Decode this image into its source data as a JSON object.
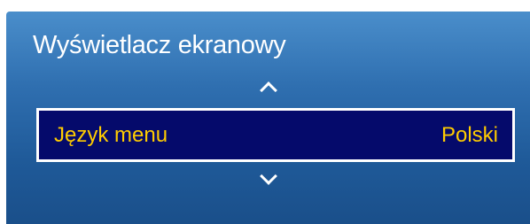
{
  "osd": {
    "title": "Wyświetlacz ekranowy",
    "menu_item": {
      "label": "Język menu",
      "value": "Polski"
    }
  },
  "colors": {
    "panel_top": "#4a8ecb",
    "panel_bottom": "#1a4f8a",
    "highlight_bg": "#050a6b",
    "highlight_border": "#ffffff",
    "highlight_text": "#ffcc00",
    "title_text": "#ffffff"
  },
  "icons": {
    "up": "chevron-up-icon",
    "down": "chevron-down-icon"
  }
}
